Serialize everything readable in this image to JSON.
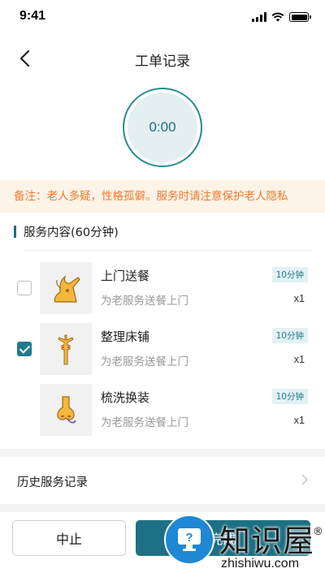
{
  "status_bar": {
    "time": "9:41"
  },
  "nav": {
    "title": "工单记录"
  },
  "timer": {
    "value": "0:00"
  },
  "note": {
    "text": "备注：老人多疑，性格孤僻。服务时请注意保护老人隐私"
  },
  "section": {
    "title": "服务内容(60分钟)"
  },
  "services": [
    {
      "name": "上门送餐",
      "desc": "为老服务送餐上门",
      "duration": "10分钟",
      "qty": "x1",
      "checked": false,
      "icon": "meal-delivery-icon"
    },
    {
      "name": "整理床铺",
      "desc": "为老服务送餐上门",
      "duration": "10分钟",
      "qty": "x1",
      "checked": true,
      "icon": "bed-making-icon"
    },
    {
      "name": "梳洗换装",
      "desc": "为老服务送餐上门",
      "duration": "10分钟",
      "qty": "x1",
      "checked": null,
      "icon": "grooming-icon"
    }
  ],
  "history": {
    "label": "历史服务记录"
  },
  "buttons": {
    "stop": "中止",
    "done": "完成"
  },
  "watermark": {
    "name": "知识屋",
    "reg": "®",
    "url": "zhishiwu.com"
  },
  "colors": {
    "primary": "#1d7083",
    "note_text": "#f07a2c",
    "note_bg": "#fdf3e7",
    "timer_bg": "#e4eff1",
    "badge_bg": "#e3f1f4",
    "icon_orange": "#f5b73b"
  }
}
